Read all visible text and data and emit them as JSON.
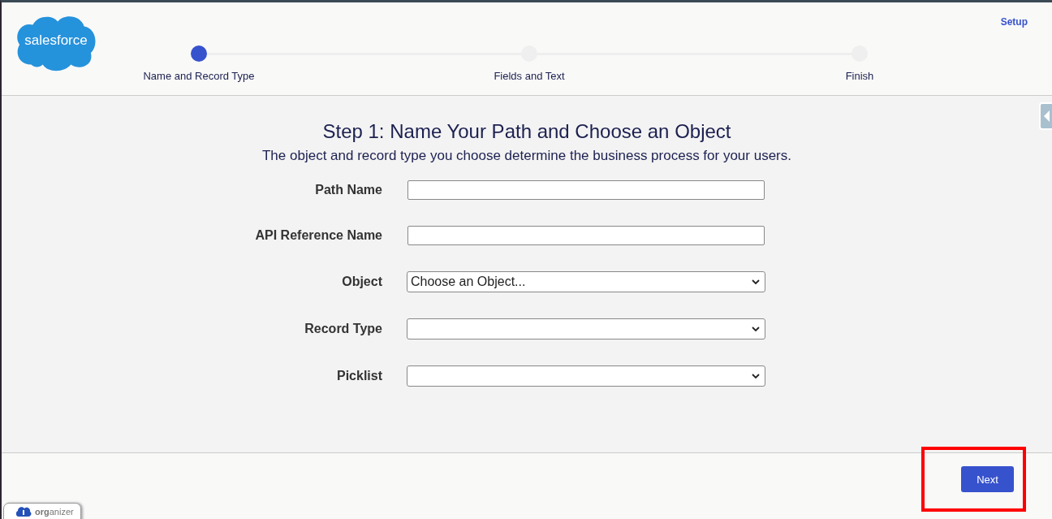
{
  "header": {
    "logo_text": "salesforce",
    "setup_link": "Setup"
  },
  "steps": [
    {
      "label": "Name and Record Type",
      "selected": true
    },
    {
      "label": "Fields and Text",
      "selected": false
    },
    {
      "label": "Finish",
      "selected": false
    }
  ],
  "title": "Step 1: Name Your Path and Choose an Object",
  "subtitle": "The object and record type you choose determine the business process for your users.",
  "fields": [
    {
      "label": "Path Name",
      "kind": "text"
    },
    {
      "label": "API Reference Name",
      "kind": "text"
    },
    {
      "label": "Object",
      "kind": "select",
      "value": "Choose an Object..."
    },
    {
      "label": "Record Type",
      "kind": "select"
    },
    {
      "label": "Picklist",
      "kind": "select"
    }
  ],
  "next_button": "Next",
  "organizer_tab": "**org**anizer"
}
